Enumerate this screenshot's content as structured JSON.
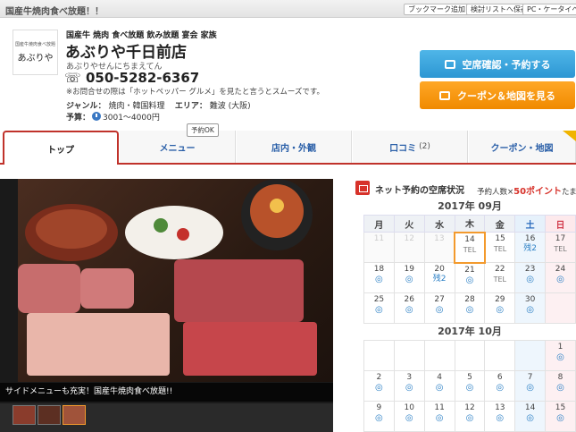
{
  "topbar": {
    "catch": "国産牛焼肉食べ放題！！",
    "buttons": [
      "ブックマーク追加",
      "検討リストへ保存",
      "PC・ケータイへ送る"
    ]
  },
  "header": {
    "logo_small": "国産牛焼肉食べ放題",
    "logo_name": "あぶりや",
    "tags": "国産牛 焼肉 食べ放題 飲み放題 宴会 家族",
    "shop_name": "あぶりや千日前店",
    "shop_kana": "あぶりやせんにちまえてん",
    "phone": "050-5282-6367",
    "note": "※お問合せの際は「ホットペッパー グルメ」を見たと言うとスムーズです。",
    "genre_label": "ジャンル：",
    "genre_value": "焼肉・韓国料理",
    "area_label": "エリア：",
    "area_value": "難波 (大阪)",
    "budget_label": "予算：",
    "budget_value": "3001～4000円",
    "reserve_button": "空席確認・予約する",
    "coupon_button": "クーポン＆地図を見る"
  },
  "tabs": {
    "items": [
      {
        "label": "トップ"
      },
      {
        "label": "メニュー"
      },
      {
        "label": "店内・外観"
      },
      {
        "label": "口コミ",
        "count": "(2)"
      },
      {
        "label": "クーポン・地図"
      }
    ],
    "menu_badge": "予約OK"
  },
  "photo": {
    "caption": "サイドメニューも充実！国産牛焼肉食べ放題!!"
  },
  "availability": {
    "title": "ネット予約の空席状況",
    "points_prefix": "予約人数×",
    "points_value": "50ポイント",
    "points_suffix": "たまる"
  },
  "calendar": {
    "weekdays": [
      "月",
      "火",
      "水",
      "木",
      "金",
      "土",
      "日"
    ],
    "months": [
      {
        "title": "2017年 09月",
        "weeks": [
          [
            {
              "d": "11",
              "s": "",
              "past": true
            },
            {
              "d": "12",
              "s": "",
              "past": true
            },
            {
              "d": "13",
              "s": "",
              "past": true
            },
            {
              "d": "14",
              "s": "TEL",
              "today": true
            },
            {
              "d": "15",
              "s": "TEL"
            },
            {
              "d": "16",
              "s": "残2",
              "type": "rem"
            },
            {
              "d": "17",
              "s": "TEL"
            }
          ],
          [
            {
              "d": "18",
              "s": "◎",
              "type": "circle"
            },
            {
              "d": "19",
              "s": "◎",
              "type": "circle"
            },
            {
              "d": "20",
              "s": "残2",
              "type": "rem"
            },
            {
              "d": "21",
              "s": "◎",
              "type": "circle"
            },
            {
              "d": "22",
              "s": "TEL"
            },
            {
              "d": "23",
              "s": "◎",
              "type": "circle"
            },
            {
              "d": "24",
              "s": "◎",
              "type": "circle"
            }
          ],
          [
            {
              "d": "25",
              "s": "◎",
              "type": "circle"
            },
            {
              "d": "26",
              "s": "◎",
              "type": "circle"
            },
            {
              "d": "27",
              "s": "◎",
              "type": "circle"
            },
            {
              "d": "28",
              "s": "◎",
              "type": "circle"
            },
            {
              "d": "29",
              "s": "◎",
              "type": "circle"
            },
            {
              "d": "30",
              "s": "◎",
              "type": "circle"
            },
            {
              "d": "",
              "s": ""
            }
          ]
        ]
      },
      {
        "title": "2017年 10月",
        "weeks": [
          [
            {
              "d": "",
              "s": ""
            },
            {
              "d": "",
              "s": ""
            },
            {
              "d": "",
              "s": ""
            },
            {
              "d": "",
              "s": ""
            },
            {
              "d": "",
              "s": ""
            },
            {
              "d": "",
              "s": ""
            },
            {
              "d": "1",
              "s": "◎",
              "type": "circle"
            }
          ],
          [
            {
              "d": "2",
              "s": "◎",
              "type": "circle"
            },
            {
              "d": "3",
              "s": "◎",
              "type": "circle"
            },
            {
              "d": "4",
              "s": "◎",
              "type": "circle"
            },
            {
              "d": "5",
              "s": "◎",
              "type": "circle"
            },
            {
              "d": "6",
              "s": "◎",
              "type": "circle"
            },
            {
              "d": "7",
              "s": "◎",
              "type": "circle"
            },
            {
              "d": "8",
              "s": "◎",
              "type": "circle"
            }
          ],
          [
            {
              "d": "9",
              "s": "◎",
              "type": "circle"
            },
            {
              "d": "10",
              "s": "◎",
              "type": "circle"
            },
            {
              "d": "11",
              "s": "◎",
              "type": "circle"
            },
            {
              "d": "12",
              "s": "◎",
              "type": "circle"
            },
            {
              "d": "13",
              "s": "◎",
              "type": "circle"
            },
            {
              "d": "14",
              "s": "◎",
              "type": "circle"
            },
            {
              "d": "15",
              "s": "◎",
              "type": "circle"
            }
          ]
        ]
      }
    ]
  }
}
